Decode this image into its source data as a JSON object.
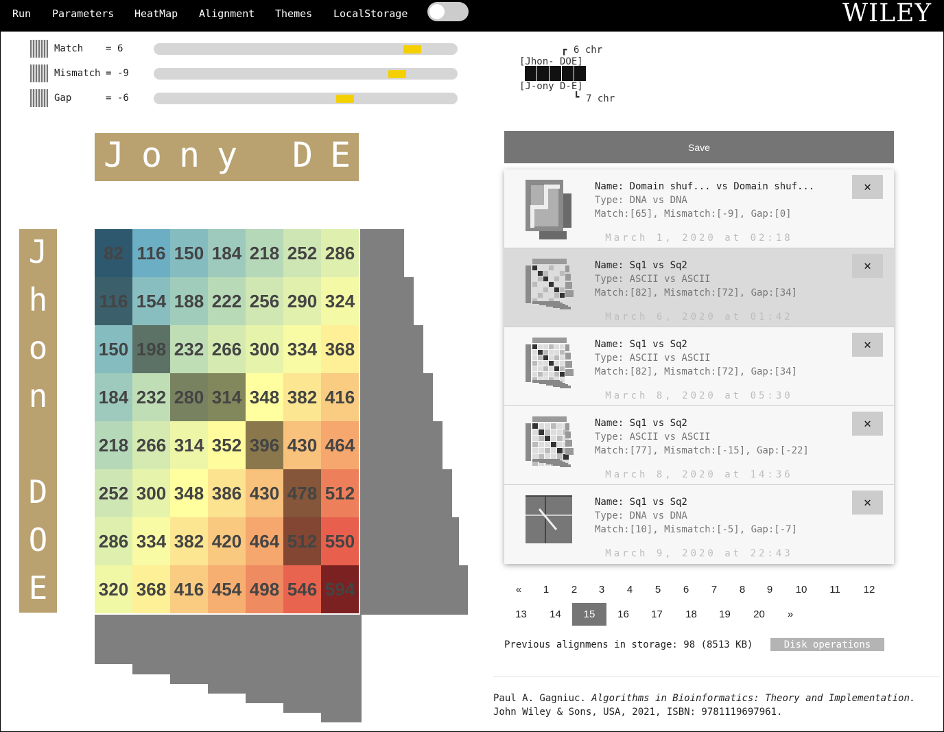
{
  "menu": {
    "items": [
      "Run",
      "Parameters",
      "HeatMap",
      "Alignment",
      "Themes",
      "LocalStorage"
    ],
    "logo": "WILEY"
  },
  "params": [
    {
      "label": "Match",
      "eq": "=",
      "value": "6",
      "level": 0.88
    },
    {
      "label": "Mismatch",
      "eq": "=",
      "value": "-9",
      "level": 0.83
    },
    {
      "label": "Gap",
      "eq": "=",
      "value": "-6",
      "level": 0.66
    }
  ],
  "alignment_preview": {
    "top_count": "6 chr",
    "seq_a": "[Jhon- DOE]",
    "seq_b": "[J-ony D-E]",
    "bottom_count": "7 chr"
  },
  "seq_a": [
    "J",
    "o",
    "n",
    "y",
    " ",
    "D",
    "E"
  ],
  "seq_b": [
    "J",
    "h",
    "o",
    "n",
    " ",
    "D",
    "O",
    "E"
  ],
  "heatmap": {
    "values": [
      [
        82,
        116,
        150,
        184,
        218,
        252,
        286
      ],
      [
        116,
        154,
        188,
        222,
        256,
        290,
        324
      ],
      [
        150,
        198,
        232,
        266,
        300,
        334,
        368
      ],
      [
        184,
        232,
        280,
        314,
        348,
        382,
        416
      ],
      [
        218,
        266,
        314,
        352,
        396,
        430,
        464
      ],
      [
        252,
        300,
        348,
        386,
        430,
        478,
        512
      ],
      [
        286,
        334,
        382,
        420,
        464,
        512,
        550
      ],
      [
        320,
        368,
        416,
        454,
        498,
        546,
        594
      ]
    ],
    "path": [
      [
        0,
        0
      ],
      [
        1,
        0
      ],
      [
        2,
        1
      ],
      [
        3,
        2
      ],
      [
        3,
        3
      ],
      [
        4,
        4
      ],
      [
        5,
        5
      ],
      [
        6,
        5
      ],
      [
        7,
        6
      ]
    ],
    "path_color": "#000000"
  },
  "save_label": "Save",
  "history": [
    {
      "name": "Name: Domain shuf... vs Domain shuf...",
      "type": "Type: DNA vs DNA",
      "score": "Match:[65], Mismatch:[-9], Gap:[0]",
      "date": "March 1, 2020 at 02:18",
      "thumb": "zig"
    },
    {
      "name": "Name: Sq1 vs Sq2",
      "type": "Type: ASCII vs ASCII",
      "score": "Match:[82], Mismatch:[72], Gap:[34]",
      "date": "March 6, 2020 at 01:42",
      "thumb": "grid"
    },
    {
      "name": "Name: Sq1 vs Sq2",
      "type": "Type: ASCII vs ASCII",
      "score": "Match:[82], Mismatch:[72], Gap:[34]",
      "date": "March 8, 2020 at 05:30",
      "thumb": "grid"
    },
    {
      "name": "Name: Sq1 vs Sq2",
      "type": "Type: ASCII vs ASCII",
      "score": "Match:[77], Mismatch:[-15], Gap:[-22]",
      "date": "March 8, 2020 at 14:36",
      "thumb": "grid2"
    },
    {
      "name": "Name: Sq1 vs Sq2",
      "type": "Type: DNA vs DNA",
      "score": "Match:[10], Mismatch:[-5], Gap:[-7]",
      "date": "March 9, 2020 at 22:43",
      "thumb": "dna"
    }
  ],
  "delete_symbol": "✕",
  "pager": {
    "row1": [
      "«",
      "1",
      "2",
      "3",
      "4",
      "5",
      "6",
      "7",
      "8",
      "9",
      "10",
      "11",
      "12"
    ],
    "row2": [
      "13",
      "14",
      "15",
      "16",
      "17",
      "18",
      "19",
      "20",
      "»"
    ],
    "active": "15"
  },
  "storage_text": "Previous alignmens in storage: 98 (8513 KB)",
  "disk_button": "Disk operations",
  "citation": {
    "author": "Paul A. Gagniuc.",
    "title": "Algorithms in Bioinformatics: Theory and Implementation.",
    "line2": "John Wiley & Sons, USA, 2021, ISBN: 9781119697961."
  }
}
